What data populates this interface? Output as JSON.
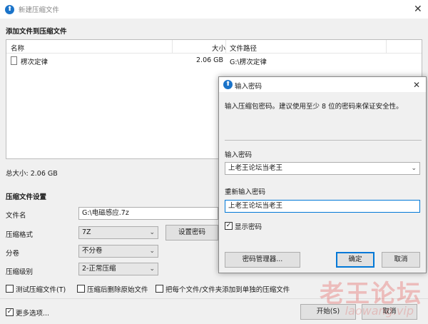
{
  "window": {
    "title": "新建压缩文件"
  },
  "add_section": {
    "title": "添加文件到压缩文件"
  },
  "file_list": {
    "columns": [
      "名称",
      "大小",
      "文件路径"
    ],
    "rows": [
      {
        "name": "楞次定律",
        "size": "2.06 GB",
        "path": "G:\\楞次定律"
      }
    ]
  },
  "total_size": "总大小: 2.06 GB",
  "settings": {
    "title": "压缩文件设置",
    "filename_label": "文件名",
    "filename_value": "G:\\电磁感应.7z",
    "format_label": "压缩格式",
    "format_value": "7Z",
    "set_password_label": "设置密码",
    "split_label": "分卷",
    "split_value": "不分卷",
    "level_label": "压缩级别",
    "level_value": "2-正常压缩",
    "test_label": "测试压缩文件(T)",
    "delete_label": "压缩后删除原始文件",
    "separate_label": "把每个文件/文件夹添加到单独的压缩文件"
  },
  "footer": {
    "more_options": "更多选项...",
    "start": "开始(S)",
    "cancel": "取消"
  },
  "password_dialog": {
    "title": "输入密码",
    "hint": "输入压缩包密码。建议使用至少 8 位的密码来保证安全性。",
    "enter_label": "输入密码",
    "enter_value": "上老王论坛当老王",
    "reenter_label": "重新输入密码",
    "reenter_value": "上老王论坛当老王",
    "show_password": "显示密码",
    "manager": "密码管理器...",
    "ok": "确定",
    "cancel": "取消"
  },
  "watermark": {
    "main": "老王论坛",
    "sub": "laowang.vip"
  },
  "colors": {
    "accent": "#0078d7",
    "app_icon": "#1a73c9",
    "watermark": "#e53935"
  }
}
